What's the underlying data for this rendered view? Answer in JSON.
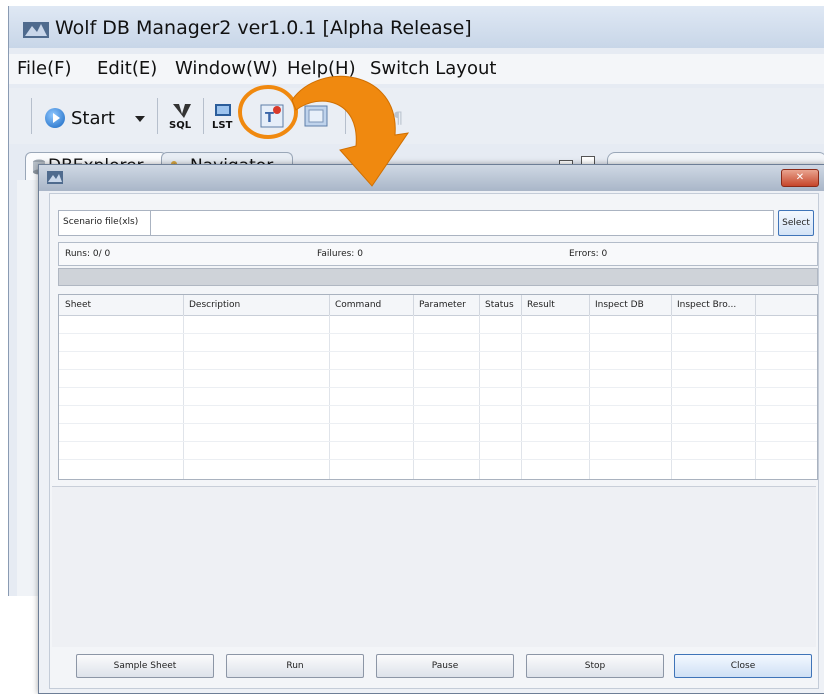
{
  "app": {
    "title": "Wolf DB Manager2 ver1.0.1 [Alpha Release]"
  },
  "menu": [
    "File(F)",
    "Edit(E)",
    "Window(W)",
    "Help(H)",
    "Switch Layout"
  ],
  "toolbar": {
    "start_label": "Start",
    "icons": [
      "sql-icon",
      "lst-icon",
      "scenario-test-icon",
      "db-icon",
      "disabled-icon-1",
      "disabled-icon-2"
    ]
  },
  "tabs": [
    "DBExplorer",
    "Navigator"
  ],
  "dialog": {
    "scenario_label": "Scenario file(xls)",
    "scenario_value": "",
    "select_label": "Select",
    "runs": "Runs:  0/  0",
    "failures": "Failures: 0",
    "errors": "Errors: 0",
    "columns": [
      "Sheet",
      "Description",
      "Command",
      "Parameter",
      "Status",
      "Result",
      "Inspect DB",
      "Inspect Bro..."
    ],
    "buttons": [
      "Sample Sheet",
      "Run",
      "Pause",
      "Stop",
      "Close"
    ]
  },
  "colors": {
    "highlight": "#f0890f",
    "accent": "#3f74b8"
  }
}
